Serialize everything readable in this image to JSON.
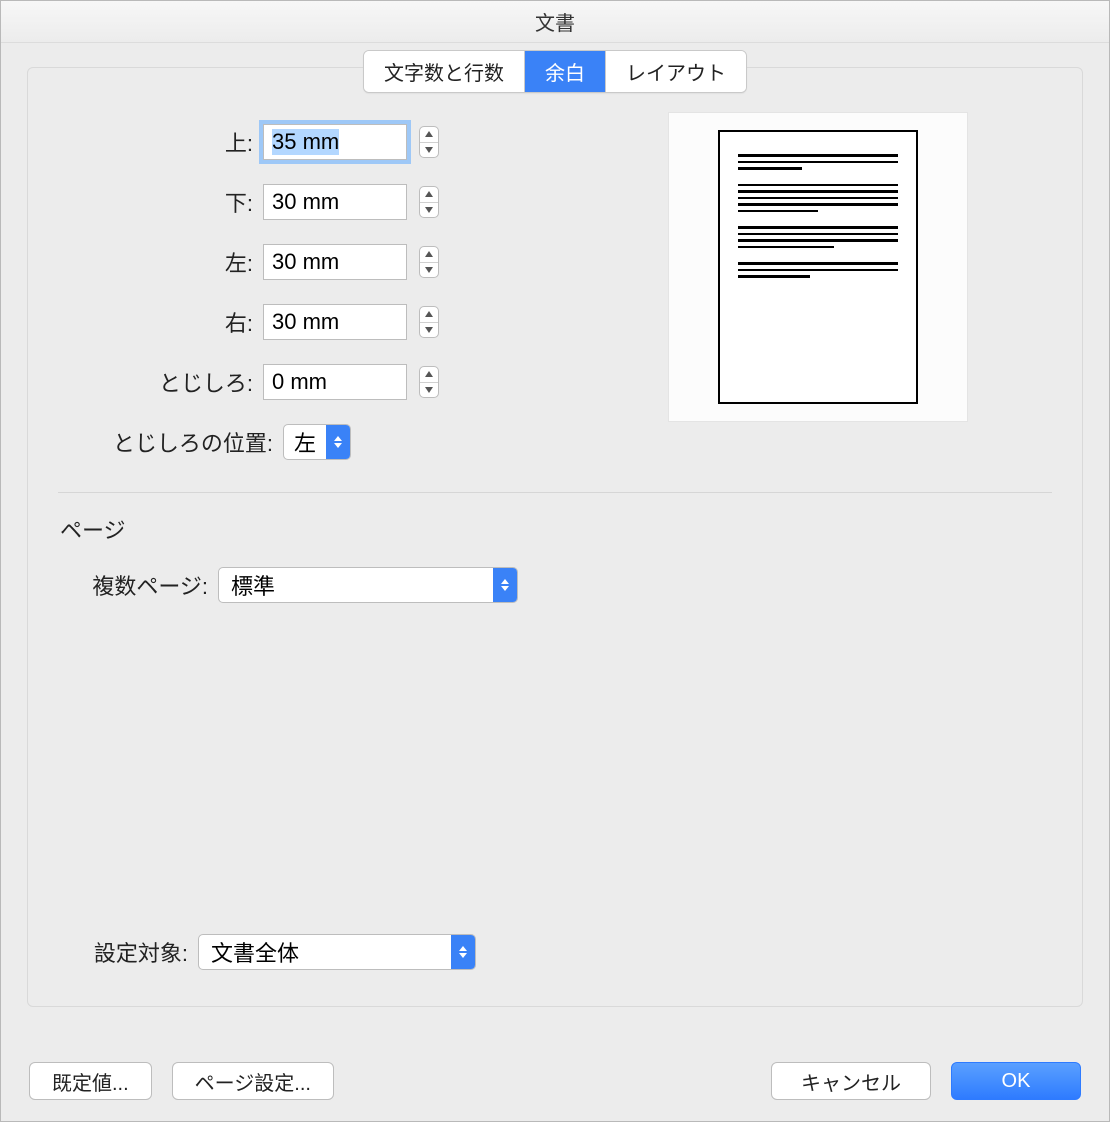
{
  "window": {
    "title": "文書"
  },
  "tabs": {
    "chars": "文字数と行数",
    "margins": "余白",
    "layout": "レイアウト"
  },
  "margins": {
    "top_label": "上:",
    "top_value": "35 mm",
    "bottom_label": "下:",
    "bottom_value": "30 mm",
    "left_label": "左:",
    "left_value": "30 mm",
    "right_label": "右:",
    "right_value": "30 mm",
    "gutter_label": "とじしろ:",
    "gutter_value": "0 mm",
    "gutter_pos_label": "とじしろの位置:",
    "gutter_pos_value": "左"
  },
  "page_section": {
    "title": "ページ",
    "multi_label": "複数ページ:",
    "multi_value": "標準"
  },
  "apply": {
    "label": "設定対象:",
    "value": "文書全体"
  },
  "footer": {
    "defaults": "既定値...",
    "page_setup": "ページ設定...",
    "cancel": "キャンセル",
    "ok": "OK"
  }
}
